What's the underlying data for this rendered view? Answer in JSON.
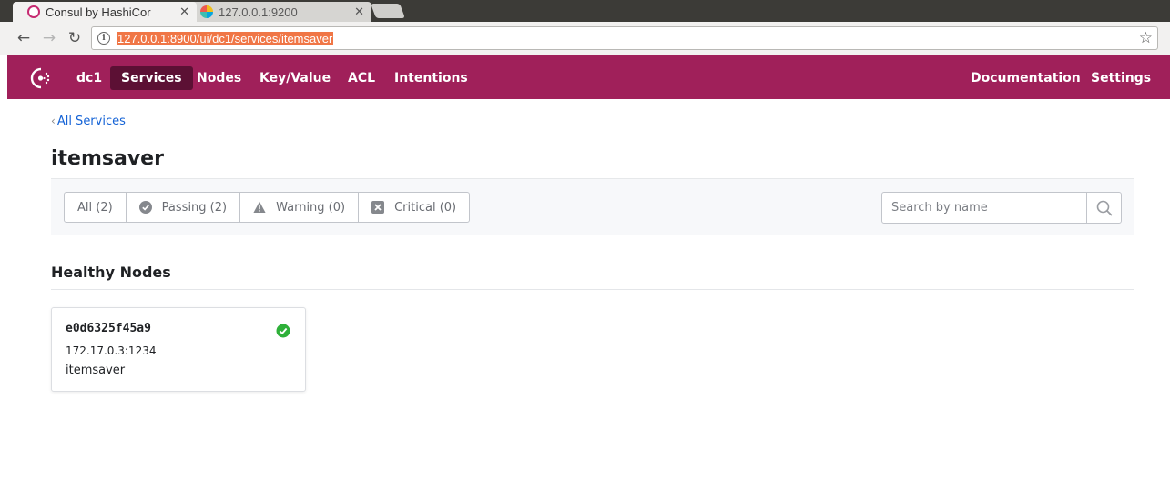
{
  "browser": {
    "tabs": [
      {
        "title": "Consul by HashiCor",
        "active": true
      },
      {
        "title": "127.0.0.1:9200",
        "active": false
      }
    ],
    "url": "127.0.0.1:8900/ui/dc1/services/itemsaver"
  },
  "nav": {
    "datacenter": "dc1",
    "items": [
      "Services",
      "Nodes",
      "Key/Value",
      "ACL",
      "Intentions"
    ],
    "active": "Services",
    "right_items": [
      "Documentation",
      "Settings"
    ],
    "brand_color": "#a0205a"
  },
  "breadcrumb": {
    "label": "All Services"
  },
  "page": {
    "title": "itemsaver"
  },
  "filters": {
    "all": "All (2)",
    "passing": "Passing (2)",
    "warning": "Warning (0)",
    "critical": "Critical (0)"
  },
  "search": {
    "placeholder": "Search by name"
  },
  "healthy": {
    "title": "Healthy Nodes",
    "nodes": [
      {
        "name": "e0d6325f45a9",
        "address": "172.17.0.3:1234",
        "service": "itemsaver",
        "status_color": "#2eb039"
      }
    ]
  }
}
